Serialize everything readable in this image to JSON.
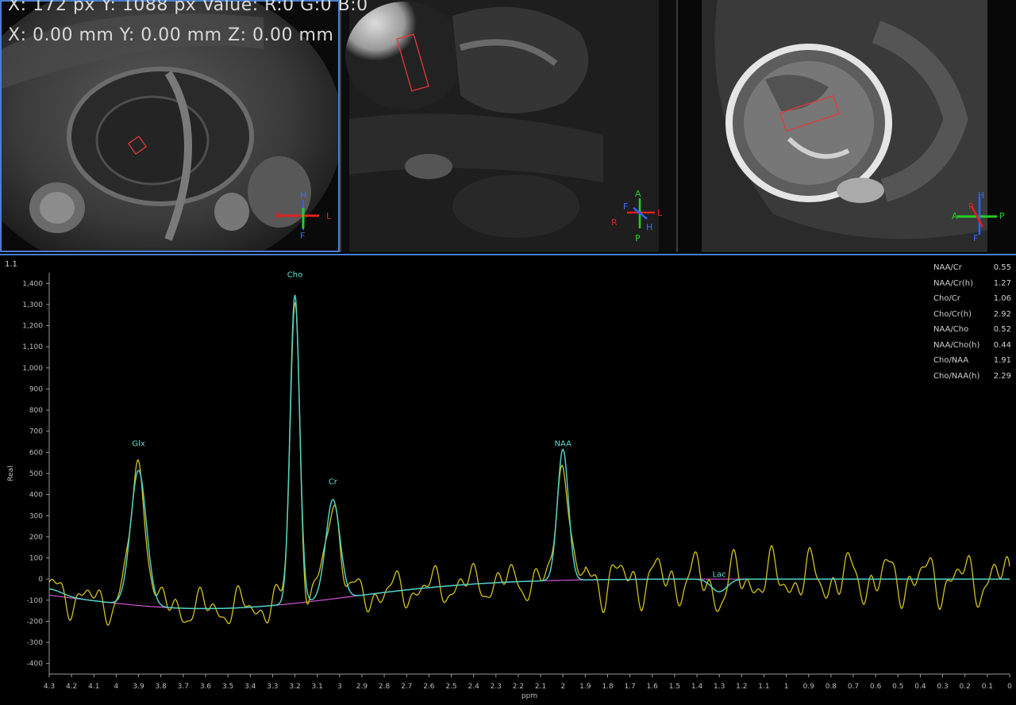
{
  "viewer": {
    "cursor_px_readout": "X: 172 px Y: 1088 px Value: R:0 G:0 B:0",
    "cursor_mm_readout": "X: 0.00 mm Y: 0.00 mm Z: 0.00 mm"
  },
  "viewports": [
    {
      "name": "axial-view",
      "orientation": {
        "top": "H",
        "left": "R",
        "right": "L",
        "bottom": "F"
      }
    },
    {
      "name": "coronal-view",
      "orientation": {
        "top": "A",
        "left": "R",
        "right": "L",
        "bottom": "P",
        "mid_left": "F",
        "mid_right": "H"
      }
    },
    {
      "name": "sagittal-view",
      "orientation": {
        "top": "H",
        "left": "A",
        "right": "P",
        "bottom": "F",
        "mid": "R"
      }
    }
  ],
  "spectrum": {
    "panel_label": "1.1",
    "ratios": [
      {
        "name": "NAA/Cr",
        "value": "0.55"
      },
      {
        "name": "NAA/Cr(h)",
        "value": "1.27"
      },
      {
        "name": "Cho/Cr",
        "value": "1.06"
      },
      {
        "name": "Cho/Cr(h)",
        "value": "2.92"
      },
      {
        "name": "NAA/Cho",
        "value": "0.52"
      },
      {
        "name": "NAA/Cho(h)",
        "value": "0.44"
      },
      {
        "name": "Cho/NAA",
        "value": "1.91"
      },
      {
        "name": "Cho/NAA(h)",
        "value": "2.29"
      }
    ]
  },
  "chart_data": {
    "type": "line",
    "xlabel": "ppm",
    "ylabel": "Real",
    "xlim": [
      4.3,
      0
    ],
    "ylim": [
      -450,
      1450
    ],
    "x_ticks": [
      "4.3",
      "4.2",
      "4.1",
      "4",
      "3.9",
      "3.8",
      "3.7",
      "3.6",
      "3.5",
      "3.4",
      "3.3",
      "3.2",
      "3.1",
      "3",
      "2.9",
      "2.8",
      "2.7",
      "2.6",
      "2.5",
      "2.4",
      "2.3",
      "2.2",
      "2.1",
      "2",
      "1.9",
      "1.8",
      "1.7",
      "1.6",
      "1.5",
      "1.4",
      "1.3",
      "1.2",
      "1.1",
      "1",
      "0.9",
      "0.8",
      "0.7",
      "0.6",
      "0.5",
      "0.4",
      "0.3",
      "0.2",
      "0.1",
      "0"
    ],
    "y_ticks": [
      "1,400",
      "1,300",
      "1,200",
      "1,100",
      "1,000",
      "900",
      "800",
      "700",
      "600",
      "500",
      "400",
      "300",
      "200",
      "100",
      "0",
      "-100",
      "-200",
      "-300",
      "-400"
    ],
    "y_tick_values": [
      1400,
      1300,
      1200,
      1100,
      1000,
      900,
      800,
      700,
      600,
      500,
      400,
      300,
      200,
      100,
      0,
      -100,
      -200,
      -300,
      -400
    ],
    "peaks": [
      {
        "label": "Glx",
        "x": 3.9,
        "y": 600
      },
      {
        "label": "Cho",
        "x": 3.2,
        "y": 1400
      },
      {
        "label": "Cr",
        "x": 3.03,
        "y": 420
      },
      {
        "label": "NAA",
        "x": 2.0,
        "y": 600
      },
      {
        "label": "Lac",
        "x": 1.3,
        "y": -20
      }
    ],
    "series": [
      {
        "name": "",
        "color": "#d4c21a",
        "kind": "measured"
      },
      {
        "name": "",
        "color": "#4fd1c5",
        "kind": "fit",
        "components": [
          {
            "x": 3.9,
            "amp": 640,
            "w": 0.05
          },
          {
            "x": 3.2,
            "amp": 1460,
            "w": 0.03
          },
          {
            "x": 3.03,
            "amp": 470,
            "w": 0.045
          },
          {
            "x": 2.0,
            "amp": 620,
            "w": 0.035
          }
        ]
      },
      {
        "name": "",
        "color": "#d455d4",
        "kind": "baseline"
      }
    ]
  }
}
